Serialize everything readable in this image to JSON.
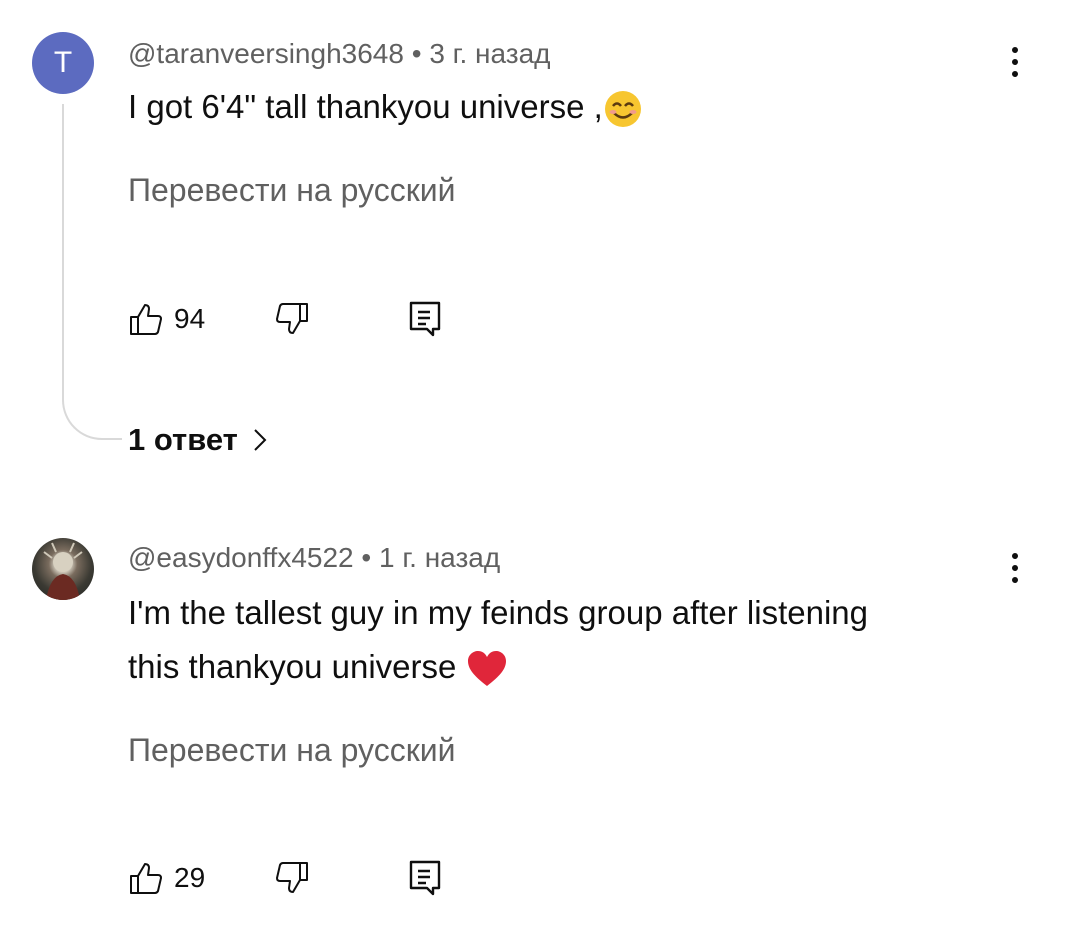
{
  "comments": [
    {
      "avatar_letter": "T",
      "author": "@taranveersingh3648",
      "separator": "•",
      "time": "3 г. назад",
      "text": "I got 6'4\" tall thankyou universe ,",
      "emoji": "smiling-face-icon",
      "translate": "Перевести на русский",
      "likes": "94",
      "replies_label": "1 ответ"
    },
    {
      "avatar": "user-avatar-image",
      "author": "@easydonffx4522",
      "separator": "•",
      "time": "1 г. назад",
      "text_line1": "I'm the tallest guy in my feinds group after listening",
      "text_line2": "this thankyou universe",
      "emoji": "red-heart-icon",
      "translate": "Перевести на русский",
      "likes": "29"
    }
  ],
  "colors": {
    "meta": "#606060",
    "text": "#0f0f0f",
    "avatar_bg": "#5c6bc0",
    "heart": "#e0263a",
    "smile": "#f7c630"
  }
}
